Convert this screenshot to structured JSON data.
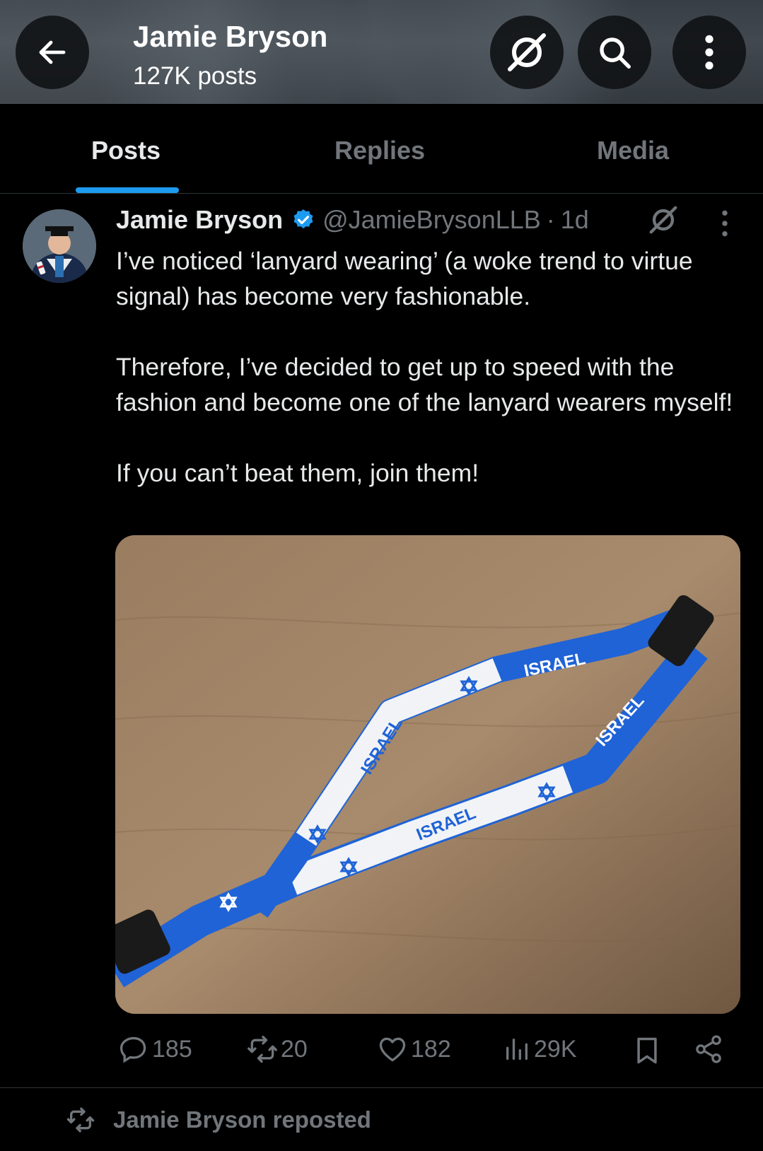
{
  "header": {
    "name": "Jamie Bryson",
    "post_count": "127K posts",
    "icons": [
      "back-arrow-icon",
      "grok-icon",
      "search-icon",
      "more-vertical-icon"
    ]
  },
  "tabs": [
    {
      "label": "Posts",
      "active": true
    },
    {
      "label": "Replies",
      "active": false
    },
    {
      "label": "Media",
      "active": false
    }
  ],
  "post": {
    "author_name": "Jamie Bryson",
    "verified": true,
    "handle": "@JamieBrysonLLB",
    "separator": "·",
    "time": "1d",
    "paragraphs": [
      "I’ve noticed ‘lanyard wearing’ (a woke trend to virtue signal) has become very fashionable.",
      "Therefore, I’ve decided to get up to speed with the fashion and become one of the lanyard wearers myself!",
      "If you can’t beat them, join them!"
    ],
    "image_labels": [
      "ISRAEL",
      "ISRAEL",
      "ISRAEL",
      "ISRAEL"
    ],
    "stats": {
      "replies": "185",
      "reposts": "20",
      "likes": "182",
      "views": "29K"
    }
  },
  "next_item": {
    "repost_text": "Jamie Bryson reposted"
  },
  "colors": {
    "background": "#000000",
    "text": "#e7e9ea",
    "muted": "#71767b",
    "accent": "#1d9bf0",
    "divider": "#2f3336",
    "flag_blue": "#1f63d6"
  }
}
